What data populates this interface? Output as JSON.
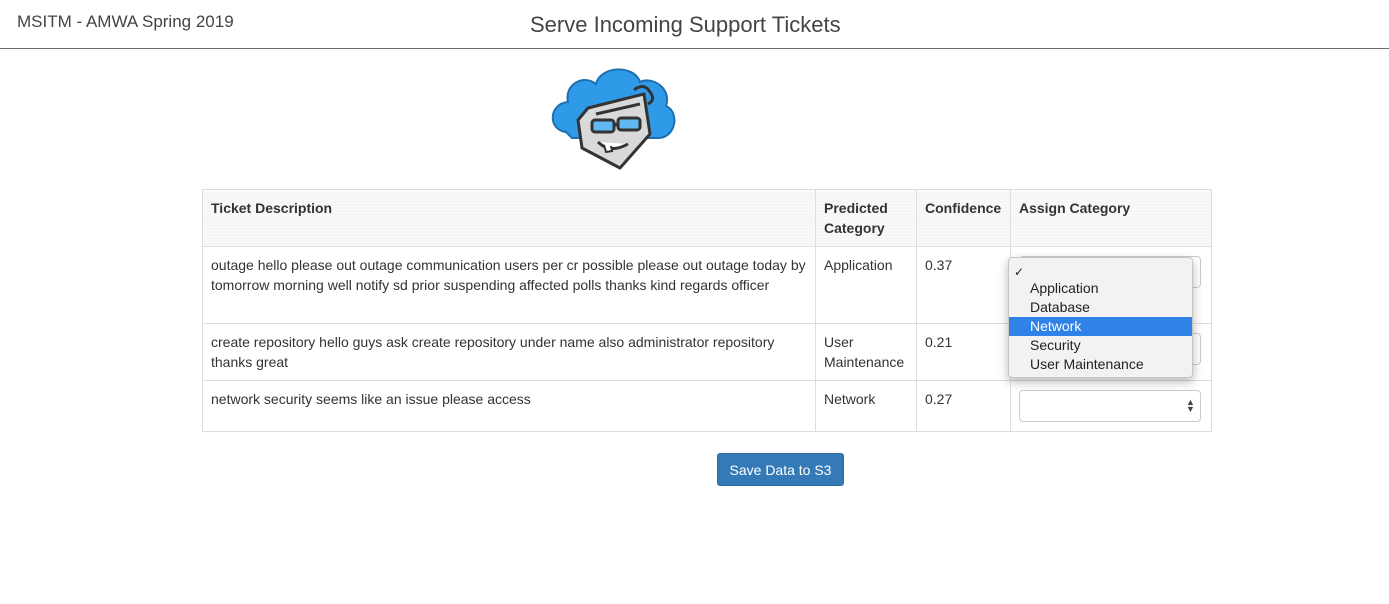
{
  "header": {
    "brand": "MSITM - AMWA Spring 2019",
    "title": "Serve Incoming Support Tickets"
  },
  "logo": {
    "icon": "cloud-mascot-icon",
    "colors": {
      "cloud": "#2f9be8",
      "face": "#d9d9d9",
      "outline": "#333333"
    }
  },
  "table": {
    "headers": [
      "Ticket Description",
      "Predicted Category",
      "Confidence",
      "Assign Category"
    ],
    "rows": [
      {
        "description": "outage hello please out outage communication users per cr possible please out outage today by tomorrow morning well notify sd prior suspending affected polls thanks kind regards officer",
        "predicted": "Application",
        "confidence": "0.37"
      },
      {
        "description": "create repository hello guys ask create repository under name also administrator repository thanks great",
        "predicted": "User Maintenance",
        "confidence": "0.21"
      },
      {
        "description": "network security seems like an issue please access",
        "predicted": "Network",
        "confidence": "0.27"
      }
    ]
  },
  "dropdown": {
    "check_mark": "✓",
    "options": [
      "Application",
      "Database",
      "Network",
      "Security",
      "User Maintenance"
    ],
    "highlighted": "Network",
    "highlight_color": "#2f82e8"
  },
  "actions": {
    "save_label": "Save Data to S3",
    "save_color": "#337ab7"
  }
}
